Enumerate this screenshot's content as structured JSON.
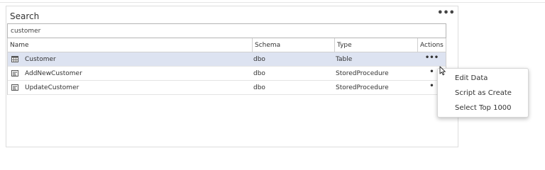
{
  "panel": {
    "title": "Search",
    "menu_label": "•••"
  },
  "search": {
    "value": "customer"
  },
  "table": {
    "columns": [
      "Name",
      "Schema",
      "Type",
      "Actions"
    ],
    "rows": [
      {
        "name": "Customer",
        "schema": "dbo",
        "type": "Table",
        "icon": "table-icon",
        "actions": "•••",
        "selected": true
      },
      {
        "name": "AddNewCustomer",
        "schema": "dbo",
        "type": "StoredProcedure",
        "icon": "stored-procedure-icon",
        "actions": "•",
        "selected": false
      },
      {
        "name": "UpdateCustomer",
        "schema": "dbo",
        "type": "StoredProcedure",
        "icon": "stored-procedure-icon",
        "actions": "•",
        "selected": false
      }
    ]
  },
  "context_menu": {
    "items": [
      "Edit Data",
      "Script as Create",
      "Select Top 1000"
    ]
  },
  "colors": {
    "selected_row": "#dde3f1",
    "border": "#d0d0d0"
  }
}
